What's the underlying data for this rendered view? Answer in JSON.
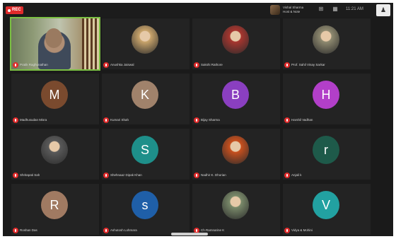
{
  "topbar": {
    "rec_label": "REC",
    "speaker_line1": "Vishal Sharma",
    "speaker_line2": "Host & Note",
    "clock": "11:21 AM"
  },
  "participants": [
    {
      "name": "Pratik Raghunathan",
      "kind": "video",
      "color": ""
    },
    {
      "name": "Anushka Jaiswal",
      "kind": "photo",
      "color": "#c9a46b"
    },
    {
      "name": "Sakshi Rathore",
      "kind": "photo",
      "color": "#a8362f"
    },
    {
      "name": "Prof. Sahil Vinay Sarkar",
      "kind": "photo",
      "color": "#8f8a70"
    },
    {
      "name": "Madhusudan Misra",
      "kind": "letter",
      "letter": "M",
      "color": "#7a4a2e"
    },
    {
      "name": "Kumari Shah",
      "kind": "letter",
      "letter": "K",
      "color": "#a0826b"
    },
    {
      "name": "Bijay Sharma",
      "kind": "letter",
      "letter": "B",
      "color": "#8a3fc0"
    },
    {
      "name": "Harshil Vadhan",
      "kind": "letter",
      "letter": "H",
      "color": "#b23fc9"
    },
    {
      "name": "Shritapati Sah",
      "kind": "photo",
      "color": "#5a5a5a"
    },
    {
      "name": "Shehnaaz Dipak Khan",
      "kind": "letter",
      "letter": "S",
      "color": "#1e8f8a"
    },
    {
      "name": "Nadhir K. Dhorian",
      "kind": "photo",
      "color": "#c8501e"
    },
    {
      "name": "Anjali k",
      "kind": "letter",
      "letter": "r",
      "color": "#1e5a4a"
    },
    {
      "name": "Roshan Das",
      "kind": "letter",
      "letter": "R",
      "color": "#a07a62"
    },
    {
      "name": "Ashutosh Lohmara",
      "kind": "letter",
      "letter": "s",
      "color": "#1f5fa8"
    },
    {
      "name": "Ch Ramnarine K",
      "kind": "photo",
      "color": "#7a8a6a"
    },
    {
      "name": "Vidya & Mohini",
      "kind": "letter",
      "letter": "V",
      "color": "#22a1a1"
    }
  ]
}
